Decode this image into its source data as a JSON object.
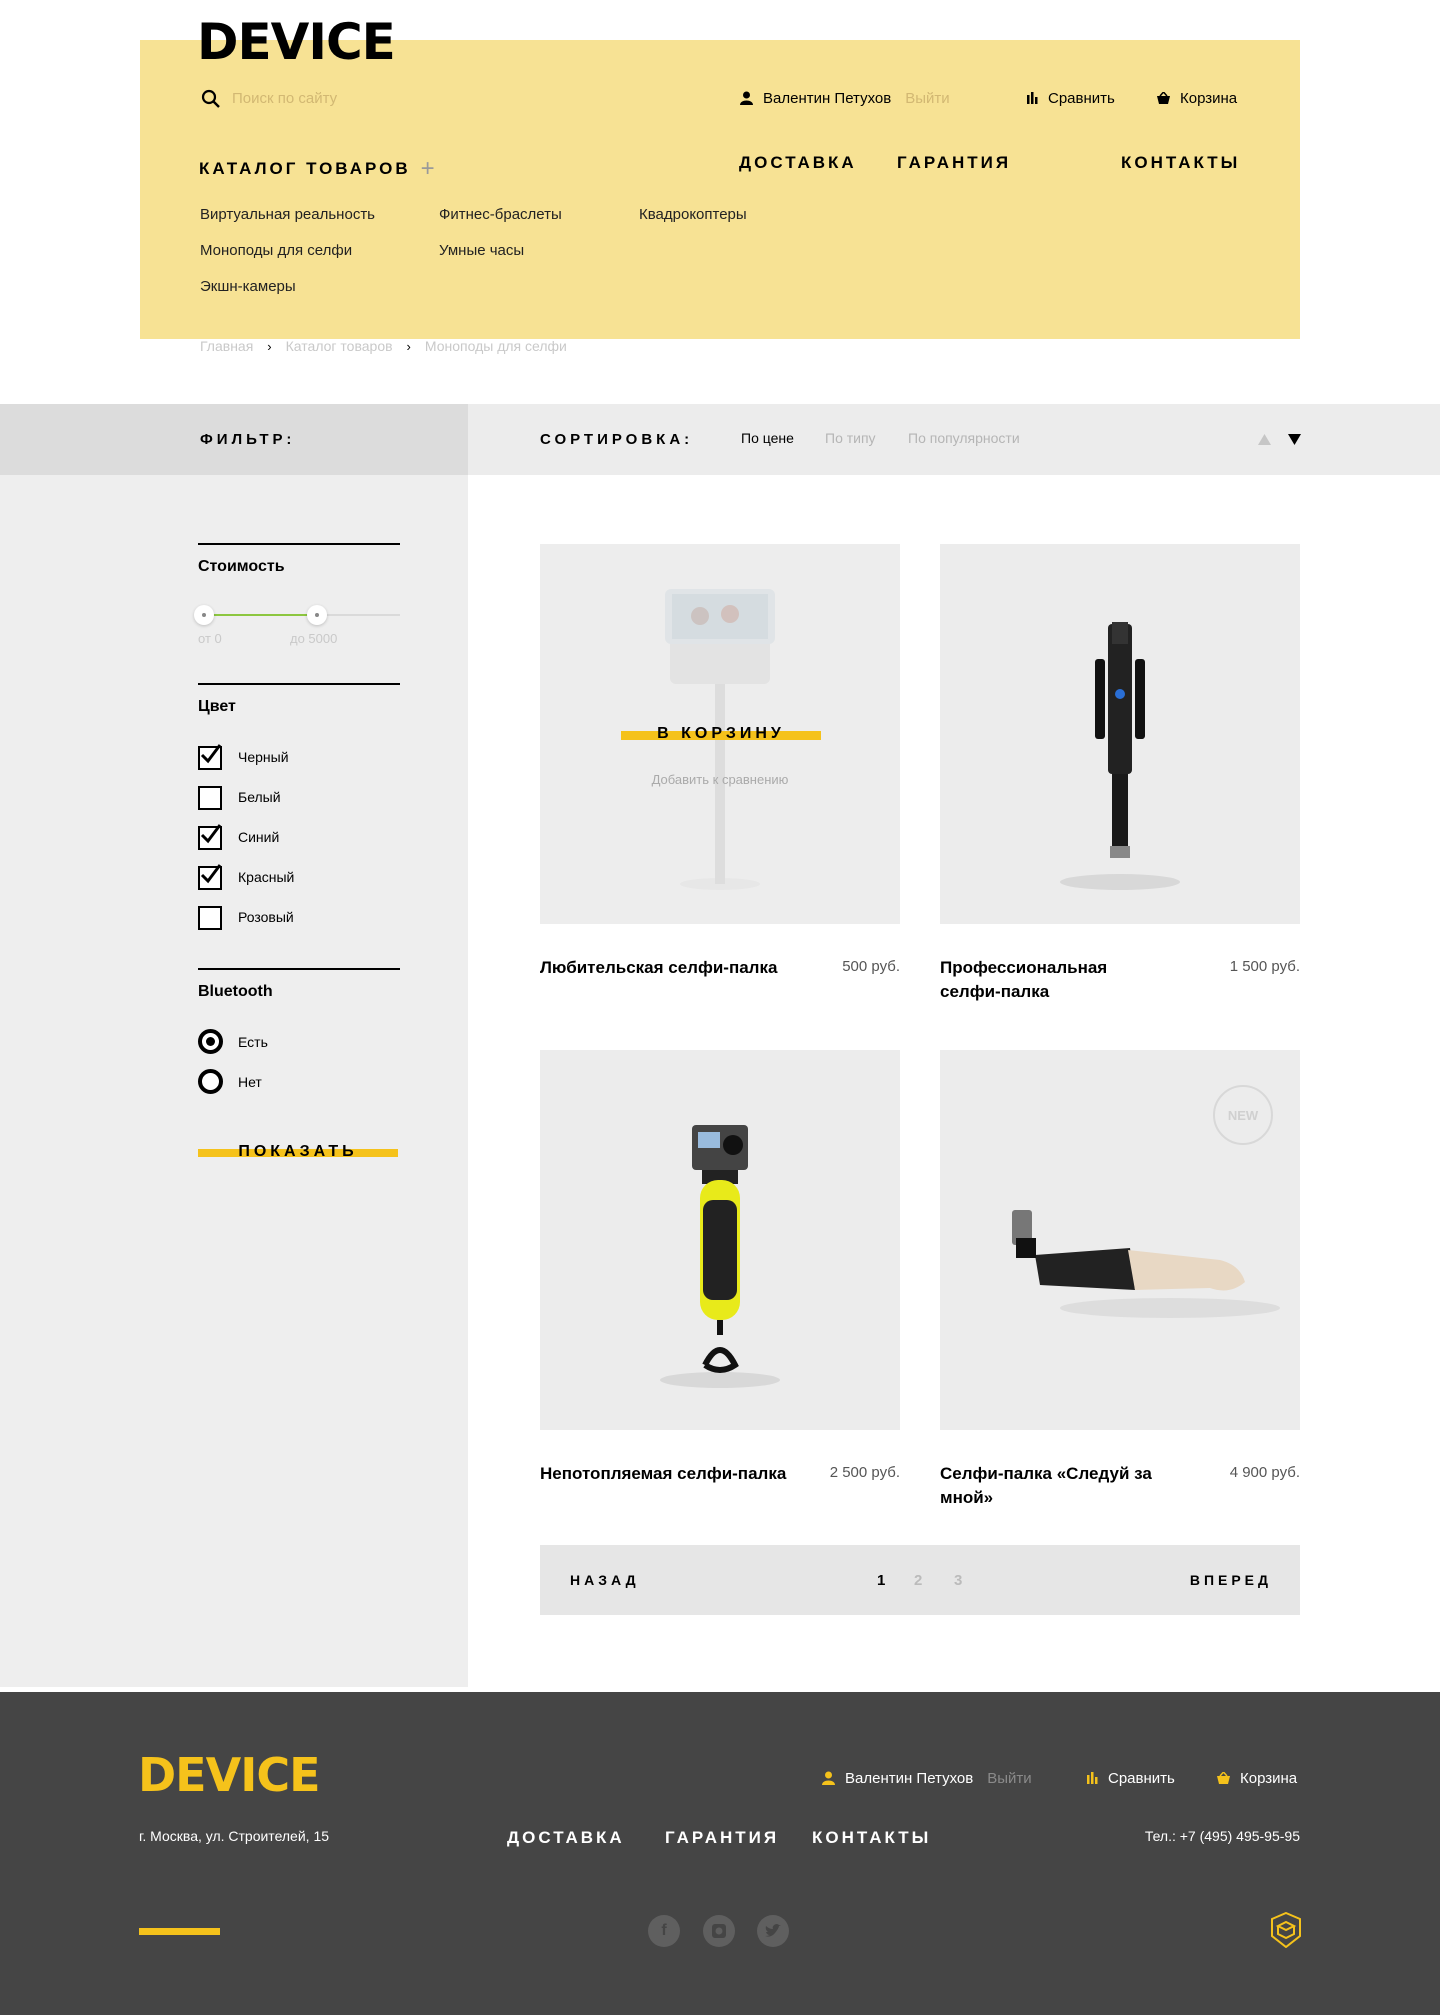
{
  "header": {
    "logo": "DEVICE",
    "search_placeholder": "Поиск по сайту",
    "user_name": "Валентин Петухов",
    "logout": "Выйти",
    "compare": "Сравнить",
    "cart": "Корзина",
    "nav": {
      "catalog": "КАТАЛОГ ТОВАРОВ",
      "delivery": "ДОСТАВКА",
      "warranty": "ГАРАНТИЯ",
      "contacts": "КОНТАКТЫ"
    },
    "submenu": [
      "Виртуальная реальность",
      "Фитнес-браслеты",
      "Квадрокоптеры",
      "Моноподы для селфи",
      "Умные часы",
      "Экшн-камеры"
    ]
  },
  "breadcrumbs": [
    "Главная",
    "Каталог товаров",
    "Моноподы для селфи"
  ],
  "filter": {
    "title": "ФИЛЬТР:",
    "price": {
      "title": "Стоимость",
      "from": "от 0",
      "to": "до 5000"
    },
    "color": {
      "title": "Цвет",
      "options": [
        {
          "label": "Черный",
          "checked": true
        },
        {
          "label": "Белый",
          "checked": false
        },
        {
          "label": "Синий",
          "checked": true
        },
        {
          "label": "Красный",
          "checked": true
        },
        {
          "label": "Розовый",
          "checked": false
        }
      ]
    },
    "bluetooth": {
      "title": "Bluetooth",
      "yes": "Есть",
      "no": "Нет",
      "selected": "Есть"
    },
    "show_button": "ПОКАЗАТЬ"
  },
  "sort": {
    "title": "СОРТИРОВКА:",
    "options": [
      "По цене",
      "По типу",
      "По популярности"
    ],
    "active": "По цене"
  },
  "products": [
    {
      "name": "Любительская селфи-палка",
      "price": "500 руб.",
      "cart_button": "В КОРЗИНУ",
      "compare_link": "Добавить к сравнению"
    },
    {
      "name": "Профессиональная селфи-палка",
      "price": "1 500 руб."
    },
    {
      "name": "Непотопляемая селфи-палка",
      "price": "2 500 руб."
    },
    {
      "name": "Селфи-палка «Следуй за мной»",
      "price": "4 900 руб.",
      "badge": "NEW"
    }
  ],
  "pagination": {
    "prev": "НАЗАД",
    "next": "ВПЕРЕД",
    "pages": [
      "1",
      "2",
      "3"
    ],
    "current": "1"
  },
  "footer": {
    "logo": "DEVICE",
    "address": "г. Москва, ул. Строителей, 15",
    "phone": "Тел.: +7 (495) 495-95-95",
    "user_name": "Валентин Петухов",
    "logout": "Выйти",
    "compare": "Сравнить",
    "cart": "Корзина",
    "nav": {
      "delivery": "ДОСТАВКА",
      "warranty": "ГАРАНТИЯ",
      "contacts": "КОНТАКТЫ"
    },
    "social": [
      "facebook-icon",
      "instagram-icon",
      "twitter-icon"
    ]
  },
  "colors": {
    "accent": "#f5c21b",
    "header_bg": "#f7e294",
    "footer_bg": "#454545"
  }
}
